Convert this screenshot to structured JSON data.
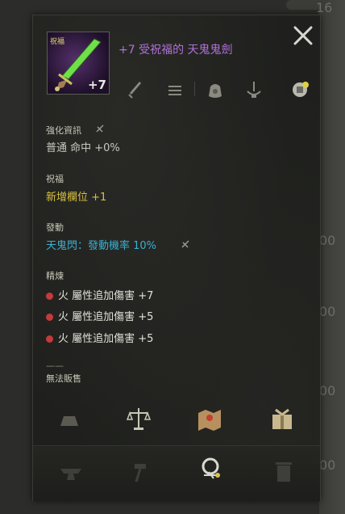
{
  "background": {
    "numbers": [
      "16",
      "00",
      "00",
      "00",
      "00"
    ]
  },
  "item": {
    "name": "+7 受祝福的 天鬼鬼劍",
    "enhance_badge": "+7",
    "icon_badge": "祝福",
    "name_color": "#b070d8"
  },
  "sections": {
    "enhance": {
      "label": "強化資訊",
      "value": "普通 命中 +0%"
    },
    "bless": {
      "label": "祝福",
      "value": "新增欄位 +1",
      "color": "#d8c040"
    },
    "trigger": {
      "label": "發動",
      "value": "天鬼閃：發動機率 10%",
      "color": "#3ab0d0"
    },
    "refine": {
      "label": "精煉",
      "lines": [
        "火 屬性追加傷害 +7",
        "火 屬性追加傷害 +5",
        "火 屬性追加傷害 +5"
      ]
    },
    "divider": "——",
    "no_sell": "無法販售"
  },
  "icons": {
    "top_row": [
      "sword-icon",
      "scroll-icon",
      "gem-bag-icon",
      "fountain-icon",
      "treasure-icon"
    ],
    "action_row": [
      "ingot-icon",
      "scale-icon",
      "map-icon",
      "gift-icon"
    ],
    "bottom_row": [
      "anvil-icon",
      "hammer-icon",
      "magnifier-icon",
      "trash-icon"
    ]
  }
}
